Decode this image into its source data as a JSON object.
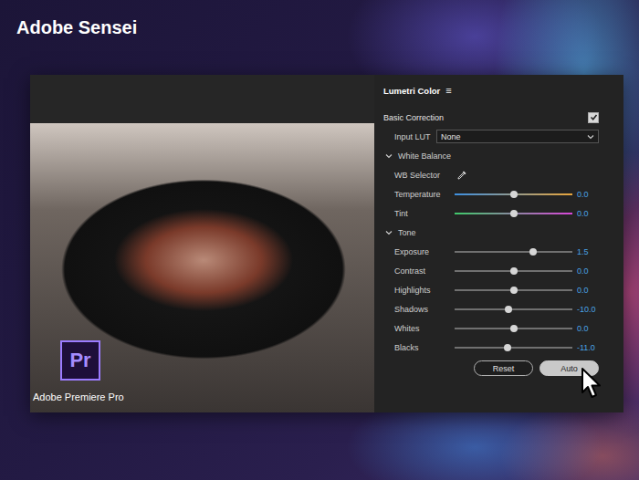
{
  "brand": {
    "title": "Adobe Sensei"
  },
  "video": {
    "logo": "Pr",
    "app_name": "Adobe Premiere Pro"
  },
  "panel": {
    "title": "Lumetri Color",
    "menu_icon": "≡",
    "section": {
      "label": "Basic Correction",
      "checked": true
    },
    "input_lut": {
      "label": "Input LUT",
      "value": "None"
    },
    "groups": [
      {
        "label": "White Balance",
        "expanded": true,
        "rows": [
          {
            "kind": "picker",
            "label": "WB Selector"
          },
          {
            "kind": "slider",
            "label": "Temperature",
            "level": 0.5,
            "reading": "0.0",
            "track_colors": [
              "#3d8fe0",
              "#e8a53c"
            ]
          },
          {
            "kind": "slider",
            "label": "Tint",
            "level": 0.5,
            "reading": "0.0",
            "track_colors": [
              "#3fc96a",
              "#d846d8"
            ]
          }
        ]
      },
      {
        "label": "Tone",
        "expanded": true,
        "rows": [
          {
            "kind": "slider",
            "label": "Exposure",
            "level": 0.67,
            "reading": "1.5",
            "track_colors": [
              "#707070",
              "#707070"
            ]
          },
          {
            "kind": "slider",
            "label": "Contrast",
            "level": 0.5,
            "reading": "0.0",
            "track_colors": [
              "#707070",
              "#707070"
            ]
          },
          {
            "kind": "slider",
            "label": "Highlights",
            "level": 0.5,
            "reading": "0.0",
            "track_colors": [
              "#707070",
              "#707070"
            ]
          },
          {
            "kind": "slider",
            "label": "Shadows",
            "level": 0.46,
            "reading": "-10.0",
            "track_colors": [
              "#707070",
              "#707070"
            ]
          },
          {
            "kind": "slider",
            "label": "Whites",
            "level": 0.5,
            "reading": "0.0",
            "track_colors": [
              "#707070",
              "#707070"
            ]
          },
          {
            "kind": "slider",
            "label": "Blacks",
            "level": 0.45,
            "reading": "-11.0",
            "track_colors": [
              "#707070",
              "#707070"
            ]
          }
        ]
      }
    ],
    "buttons": [
      {
        "label": "Reset",
        "hovered": false
      },
      {
        "label": "Auto",
        "hovered": true
      }
    ]
  }
}
